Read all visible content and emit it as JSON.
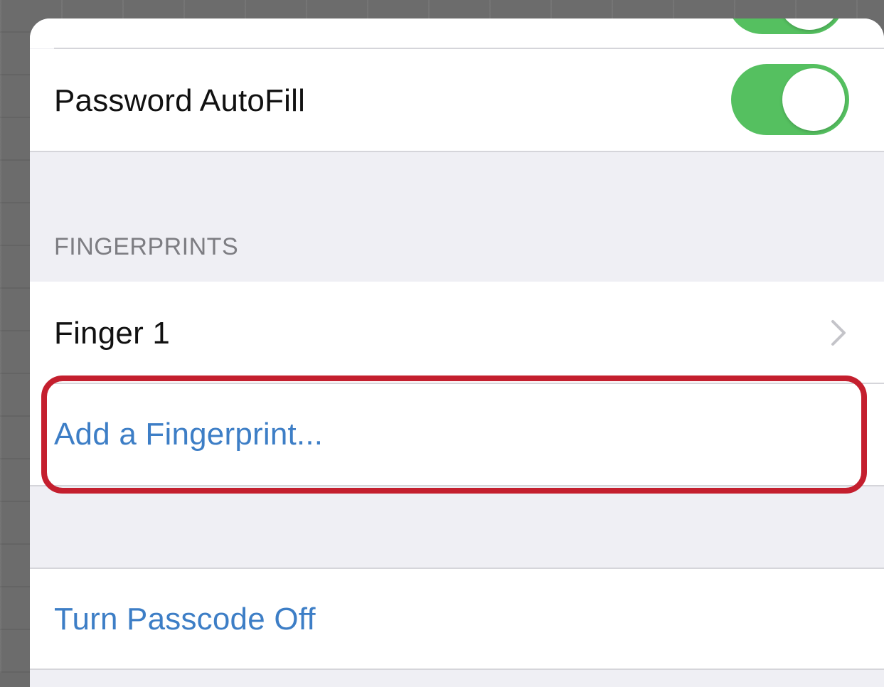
{
  "settings": {
    "password_autofill": {
      "label": "Password AutoFill",
      "toggle_on": true
    },
    "fingerprints_header": "FINGERPRINTS",
    "finger_1": {
      "label": "Finger 1"
    },
    "add_fingerprint": {
      "label": "Add a Fingerprint..."
    },
    "turn_passcode_off": {
      "label": "Turn Passcode Off"
    }
  },
  "colors": {
    "toggle_on": "#55c060",
    "link": "#3d7ec6",
    "highlight": "#c41f2e",
    "group_background": "#efeff4"
  }
}
